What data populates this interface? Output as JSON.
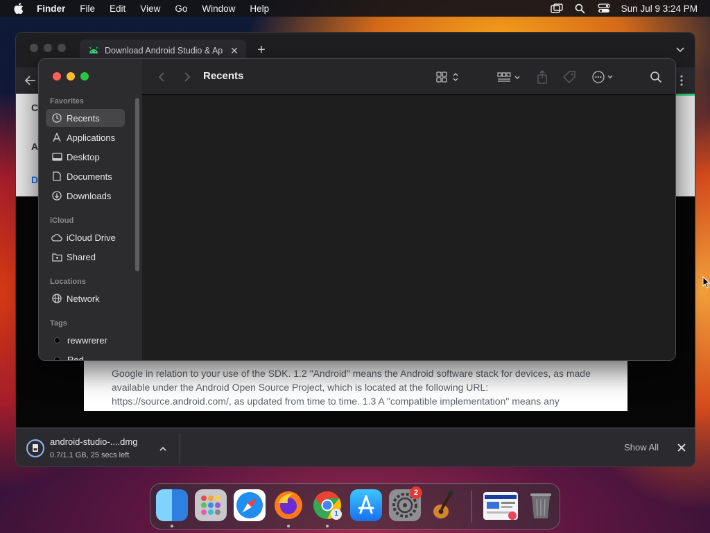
{
  "menubar": {
    "app_name": "Finder",
    "items": [
      "File",
      "Edit",
      "View",
      "Go",
      "Window",
      "Help"
    ],
    "clock": "Sun Jul 9  3:24 PM",
    "icons": [
      "screen-mirroring-icon",
      "spotlight-search-icon",
      "control-center-icon"
    ]
  },
  "browser": {
    "tab_title": "Download Android Studio & Ap",
    "license_text": "Google in relation to your use of the SDK. 1.2 \"Android\" means the Android software stack for devices, as made available under the Android Open Source Project, which is located at the following URL: https://source.android.com/, as updated from time to time. 1.3 A \"compatible implementation\" means any",
    "download": {
      "filename": "android-studio-....dmg",
      "status": "0.7/1.1 GB, 25 secs left",
      "show_all": "Show All"
    },
    "page_letters": [
      "C",
      "A",
      "D"
    ]
  },
  "finder": {
    "title": "Recents",
    "sections": {
      "favorites": "Favorites",
      "icloud": "iCloud",
      "locations": "Locations",
      "tags": "Tags"
    },
    "favorites": [
      "Recents",
      "Applications",
      "Desktop",
      "Documents",
      "Downloads"
    ],
    "icloud": [
      "iCloud Drive",
      "Shared"
    ],
    "locations": [
      "Network"
    ],
    "tags": [
      "rewwrerer",
      "Red"
    ]
  },
  "dock": {
    "apps": [
      "Finder",
      "Launchpad",
      "Safari",
      "Firefox",
      "Google Chrome",
      "App Store",
      "System Settings",
      "GarageBand",
      "Downloads stack",
      "Trash"
    ],
    "settings_badge": "2",
    "chrome_badge": "1"
  },
  "colors": {
    "close": "#ff5f57",
    "minimize": "#febc2e",
    "zoom": "#28c840",
    "badge": "#e53935"
  }
}
